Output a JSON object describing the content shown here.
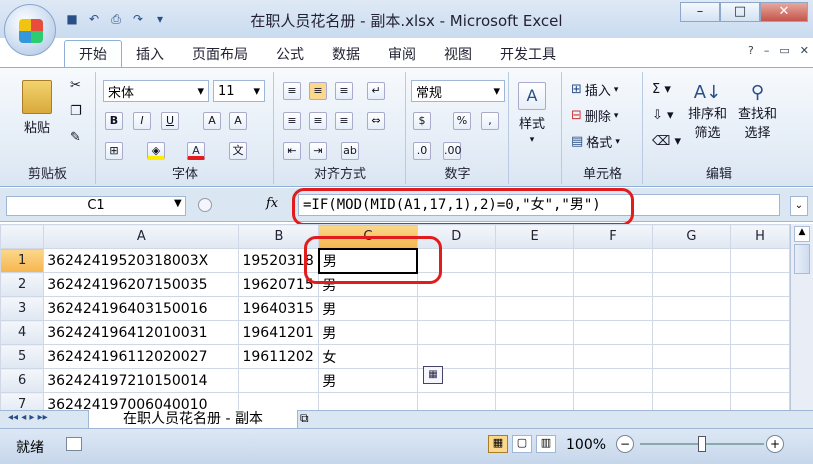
{
  "window": {
    "title": "在职人员花名册 - 副本.xlsx - Microsoft Excel"
  },
  "tabs": [
    "开始",
    "插入",
    "页面布局",
    "公式",
    "数据",
    "审阅",
    "视图",
    "开发工具"
  ],
  "ribbon": {
    "clipboard": {
      "paste": "粘贴",
      "label": "剪贴板"
    },
    "font": {
      "name": "宋体",
      "size": "11",
      "label": "字体"
    },
    "align": {
      "label": "对齐方式"
    },
    "number": {
      "format": "常规",
      "label": "数字"
    },
    "style": {
      "label": "样式"
    },
    "cells": {
      "insert": "插入",
      "delete": "删除",
      "format": "格式",
      "label": "单元格"
    },
    "edit": {
      "sort": "排序和",
      "filter": "筛选",
      "find": "查找和",
      "select": "选择",
      "label": "编辑"
    }
  },
  "namebox": "C1",
  "fx": "fx",
  "formula": "=IF(MOD(MID(A1,17,1),2)=0,\"女\",\"男\")",
  "columns": [
    "A",
    "B",
    "C",
    "D",
    "E",
    "F",
    "G",
    "H"
  ],
  "rows": [
    {
      "n": "1",
      "a": "36242419520318003X",
      "b": "19520318",
      "c": "男"
    },
    {
      "n": "2",
      "a": "362424196207150035",
      "b": "19620715",
      "c": "男"
    },
    {
      "n": "3",
      "a": "362424196403150016",
      "b": "19640315",
      "c": "男"
    },
    {
      "n": "4",
      "a": "362424196412010031",
      "b": "19641201",
      "c": "男"
    },
    {
      "n": "5",
      "a": "362424196112020027",
      "b": "19611202",
      "c": "女"
    },
    {
      "n": "6",
      "a": "362424197210150014",
      "b": "",
      "c": "男"
    },
    {
      "n": "7",
      "a": "362424197006040010",
      "b": "",
      "c": ""
    }
  ],
  "sheet": "在职人员花名册 - 副本",
  "status": {
    "ready": "就绪",
    "zoom": "100%"
  }
}
